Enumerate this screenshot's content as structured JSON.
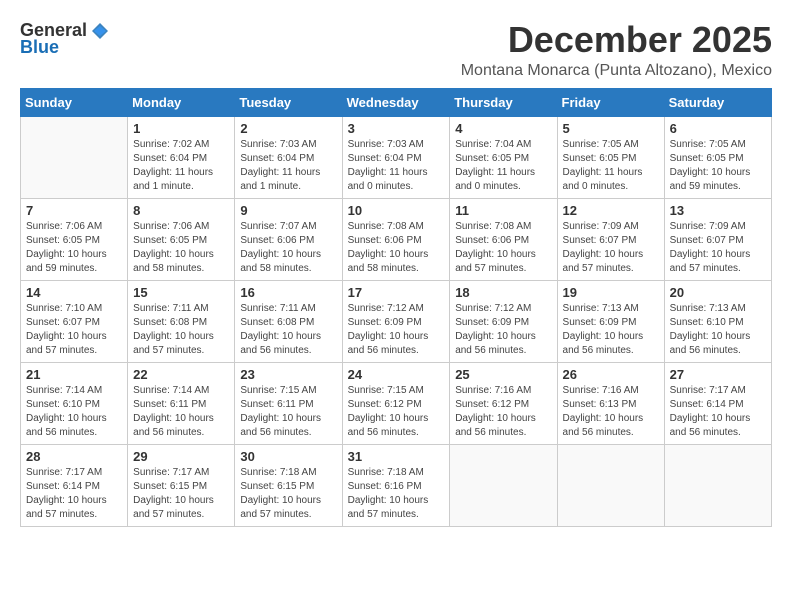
{
  "logo": {
    "general": "General",
    "blue": "Blue"
  },
  "title": {
    "month": "December 2025",
    "location": "Montana Monarca (Punta Altozano), Mexico"
  },
  "calendar": {
    "headers": [
      "Sunday",
      "Monday",
      "Tuesday",
      "Wednesday",
      "Thursday",
      "Friday",
      "Saturday"
    ],
    "weeks": [
      [
        {
          "day": "",
          "sunrise": "",
          "sunset": "",
          "daylight": "",
          "empty": true
        },
        {
          "day": "1",
          "sunrise": "Sunrise: 7:02 AM",
          "sunset": "Sunset: 6:04 PM",
          "daylight": "Daylight: 11 hours and 1 minute."
        },
        {
          "day": "2",
          "sunrise": "Sunrise: 7:03 AM",
          "sunset": "Sunset: 6:04 PM",
          "daylight": "Daylight: 11 hours and 1 minute."
        },
        {
          "day": "3",
          "sunrise": "Sunrise: 7:03 AM",
          "sunset": "Sunset: 6:04 PM",
          "daylight": "Daylight: 11 hours and 0 minutes."
        },
        {
          "day": "4",
          "sunrise": "Sunrise: 7:04 AM",
          "sunset": "Sunset: 6:05 PM",
          "daylight": "Daylight: 11 hours and 0 minutes."
        },
        {
          "day": "5",
          "sunrise": "Sunrise: 7:05 AM",
          "sunset": "Sunset: 6:05 PM",
          "daylight": "Daylight: 11 hours and 0 minutes."
        },
        {
          "day": "6",
          "sunrise": "Sunrise: 7:05 AM",
          "sunset": "Sunset: 6:05 PM",
          "daylight": "Daylight: 10 hours and 59 minutes."
        }
      ],
      [
        {
          "day": "7",
          "sunrise": "Sunrise: 7:06 AM",
          "sunset": "Sunset: 6:05 PM",
          "daylight": "Daylight: 10 hours and 59 minutes."
        },
        {
          "day": "8",
          "sunrise": "Sunrise: 7:06 AM",
          "sunset": "Sunset: 6:05 PM",
          "daylight": "Daylight: 10 hours and 58 minutes."
        },
        {
          "day": "9",
          "sunrise": "Sunrise: 7:07 AM",
          "sunset": "Sunset: 6:06 PM",
          "daylight": "Daylight: 10 hours and 58 minutes."
        },
        {
          "day": "10",
          "sunrise": "Sunrise: 7:08 AM",
          "sunset": "Sunset: 6:06 PM",
          "daylight": "Daylight: 10 hours and 58 minutes."
        },
        {
          "day": "11",
          "sunrise": "Sunrise: 7:08 AM",
          "sunset": "Sunset: 6:06 PM",
          "daylight": "Daylight: 10 hours and 57 minutes."
        },
        {
          "day": "12",
          "sunrise": "Sunrise: 7:09 AM",
          "sunset": "Sunset: 6:07 PM",
          "daylight": "Daylight: 10 hours and 57 minutes."
        },
        {
          "day": "13",
          "sunrise": "Sunrise: 7:09 AM",
          "sunset": "Sunset: 6:07 PM",
          "daylight": "Daylight: 10 hours and 57 minutes."
        }
      ],
      [
        {
          "day": "14",
          "sunrise": "Sunrise: 7:10 AM",
          "sunset": "Sunset: 6:07 PM",
          "daylight": "Daylight: 10 hours and 57 minutes."
        },
        {
          "day": "15",
          "sunrise": "Sunrise: 7:11 AM",
          "sunset": "Sunset: 6:08 PM",
          "daylight": "Daylight: 10 hours and 57 minutes."
        },
        {
          "day": "16",
          "sunrise": "Sunrise: 7:11 AM",
          "sunset": "Sunset: 6:08 PM",
          "daylight": "Daylight: 10 hours and 56 minutes."
        },
        {
          "day": "17",
          "sunrise": "Sunrise: 7:12 AM",
          "sunset": "Sunset: 6:09 PM",
          "daylight": "Daylight: 10 hours and 56 minutes."
        },
        {
          "day": "18",
          "sunrise": "Sunrise: 7:12 AM",
          "sunset": "Sunset: 6:09 PM",
          "daylight": "Daylight: 10 hours and 56 minutes."
        },
        {
          "day": "19",
          "sunrise": "Sunrise: 7:13 AM",
          "sunset": "Sunset: 6:09 PM",
          "daylight": "Daylight: 10 hours and 56 minutes."
        },
        {
          "day": "20",
          "sunrise": "Sunrise: 7:13 AM",
          "sunset": "Sunset: 6:10 PM",
          "daylight": "Daylight: 10 hours and 56 minutes."
        }
      ],
      [
        {
          "day": "21",
          "sunrise": "Sunrise: 7:14 AM",
          "sunset": "Sunset: 6:10 PM",
          "daylight": "Daylight: 10 hours and 56 minutes."
        },
        {
          "day": "22",
          "sunrise": "Sunrise: 7:14 AM",
          "sunset": "Sunset: 6:11 PM",
          "daylight": "Daylight: 10 hours and 56 minutes."
        },
        {
          "day": "23",
          "sunrise": "Sunrise: 7:15 AM",
          "sunset": "Sunset: 6:11 PM",
          "daylight": "Daylight: 10 hours and 56 minutes."
        },
        {
          "day": "24",
          "sunrise": "Sunrise: 7:15 AM",
          "sunset": "Sunset: 6:12 PM",
          "daylight": "Daylight: 10 hours and 56 minutes."
        },
        {
          "day": "25",
          "sunrise": "Sunrise: 7:16 AM",
          "sunset": "Sunset: 6:12 PM",
          "daylight": "Daylight: 10 hours and 56 minutes."
        },
        {
          "day": "26",
          "sunrise": "Sunrise: 7:16 AM",
          "sunset": "Sunset: 6:13 PM",
          "daylight": "Daylight: 10 hours and 56 minutes."
        },
        {
          "day": "27",
          "sunrise": "Sunrise: 7:17 AM",
          "sunset": "Sunset: 6:14 PM",
          "daylight": "Daylight: 10 hours and 56 minutes."
        }
      ],
      [
        {
          "day": "28",
          "sunrise": "Sunrise: 7:17 AM",
          "sunset": "Sunset: 6:14 PM",
          "daylight": "Daylight: 10 hours and 57 minutes."
        },
        {
          "day": "29",
          "sunrise": "Sunrise: 7:17 AM",
          "sunset": "Sunset: 6:15 PM",
          "daylight": "Daylight: 10 hours and 57 minutes."
        },
        {
          "day": "30",
          "sunrise": "Sunrise: 7:18 AM",
          "sunset": "Sunset: 6:15 PM",
          "daylight": "Daylight: 10 hours and 57 minutes."
        },
        {
          "day": "31",
          "sunrise": "Sunrise: 7:18 AM",
          "sunset": "Sunset: 6:16 PM",
          "daylight": "Daylight: 10 hours and 57 minutes."
        },
        {
          "day": "",
          "sunrise": "",
          "sunset": "",
          "daylight": "",
          "empty": true
        },
        {
          "day": "",
          "sunrise": "",
          "sunset": "",
          "daylight": "",
          "empty": true
        },
        {
          "day": "",
          "sunrise": "",
          "sunset": "",
          "daylight": "",
          "empty": true
        }
      ]
    ]
  }
}
